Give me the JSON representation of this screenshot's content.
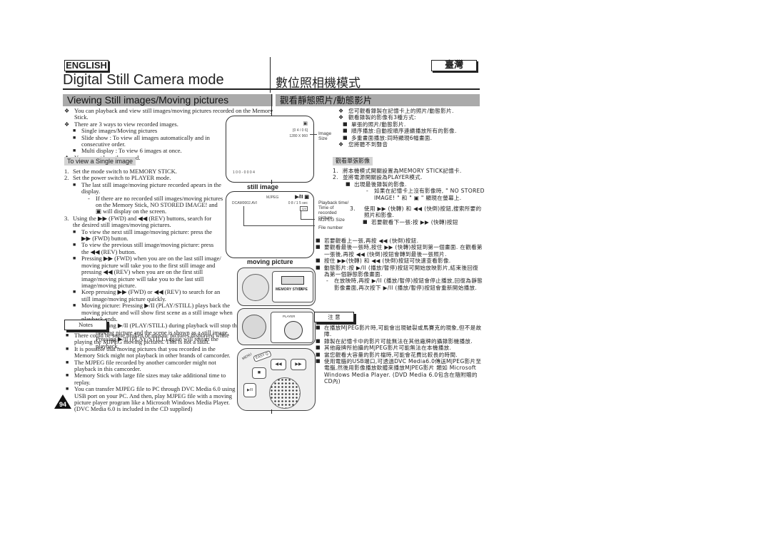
{
  "header": {
    "lang_en": "ENGLISH",
    "lang_zh": "臺灣",
    "title_en": "Digital Still Camera mode",
    "title_zh": "數位照相機模式",
    "section_en": "Viewing Still images/Moving pictures",
    "section_zh": "觀看靜態照片/動態影片"
  },
  "intro_en": [
    {
      "bullet": "diamond",
      "text": "You can playback and view still images/moving pictures recorded on the Memory Stick."
    },
    {
      "bullet": "diamond",
      "text": "There are 3 ways to view recorded images."
    },
    {
      "bullet": "square",
      "text": "Single images/Moving pictures"
    },
    {
      "bullet": "square",
      "text": "Slide show : To view all images automatically and in consecutive order."
    },
    {
      "bullet": "square",
      "text": "Multi display : To view 6 images at once."
    },
    {
      "bullet": "diamond",
      "text": "You cannot hear the sound."
    }
  ],
  "subsection_en": "To view a Single image",
  "steps_en": {
    "s1": "Set the mode switch to MEMORY STICK.",
    "s2": "Set the power switch to PLAYER mode.",
    "s2a": "The last still image/moving picture recorded apears in the display.",
    "s2b": "If there are no recorded still images/moving pictures on the Memory Stick, NO STORED IMAGE! and ▣ will display on the screen.",
    "s3": "Using the ▶▶ (FWD) and ◀◀ (REV) buttons, search for the desired still images/moving pictures.",
    "s3a": "To view the next still image/moving picture: press the ▶▶ (FWD) button.",
    "s3b": "To view the previous still image/moving picture: press the ◀◀ (REV) button.",
    "s3c": "Pressing ▶▶ (FWD) when you are on the last still image/ moving picture will take you to the first still image and pressing ◀◀ (REV) when you are on the first still image/moving picture will take you to the last still image/moving picture.",
    "s3d": "Keep pressing ▶▶ (FWD) or ◀◀ (REV) to search for an still image/moving picture quickly.",
    "s3e": "Moving picture: Pressing ▶/II (PLAY/STILL) plays back the moving picture and will show first scene as a still image when playback ends.",
    "s3f": "Pressing ▶/II (PLAY/STILL) during playback will stop the moving picture and the scene is shown as a still image. Pressing ▶/II (PLAY/STILL) again will restart the playback.",
    "n1": "1.",
    "n2": "2.",
    "n3": "3."
  },
  "notes_en": {
    "title": "Notes",
    "items": [
      "There could be some broken or mosaic pictures displayed while playing the MJPEG moving pictures. This is not a fault.",
      "It is possible that moving pictures that you recorded in the Memory Stick might not playback in other brands of camcorder.",
      "The MJPEG file recorded by another camcorder might not playback in this camcorder.",
      "Memory Stick with large file sizes may take additional time to replay.",
      "You can transfer MJPEG file to PC through DVC Media 6.0 using USB port on your PC. And then, play MJPEG file with a moving picture player program like a Microsoft Windows Media Player. (DVC Media 6.0 is included in the CD supplied)"
    ]
  },
  "page_number": "94",
  "figure": {
    "screen1": {
      "icon": "▣",
      "counter": "[0 4 / 0 6]",
      "size": "1280 X 960",
      "folder": "1 0 0 - 0 0 0 4"
    },
    "label_image_size": "Image Size",
    "caption_still": "still image",
    "screen2": {
      "format": "MJPEG",
      "play_icon": "▶/II ▣",
      "filename": "DCAM0002.AVI",
      "time": "0 8 / 1 5 sec",
      "size_icon": "320"
    },
    "label_playback": "Playback time/ Time of recorded picture",
    "label_mjpeg_size": "MJPEG Size",
    "label_file_number": "File number",
    "caption_moving": "moving picture",
    "switch_memory": "MEMORY STICK",
    "switch_tape": "TAPE",
    "dial_label": "PLAYER",
    "btn_rev": "◀◀",
    "btn_fwd": "▶▶",
    "btn_stop": "■",
    "btn_play": "▶/II",
    "btn_easy": "EASY Q",
    "btn_menu": "MENU"
  },
  "intro_zh": [
    {
      "bullet": "diamond",
      "text": "您可觀看錄製在記憶卡上的照片/動態影片."
    },
    {
      "bullet": "diamond",
      "text": "觀看錄製的影像有3種方式:"
    },
    {
      "bullet": "square",
      "text": "單張的照片/動態影片."
    },
    {
      "bullet": "square",
      "text": "順序播放:自動按順序連續播放所有的影像."
    },
    {
      "bullet": "square",
      "text": "多重畫面播放:同時顯現6幅畫面."
    },
    {
      "bullet": "diamond",
      "text": "您將聽不到聲音"
    }
  ],
  "subsection_zh": "觀看單張影像",
  "steps_zh": {
    "s1": "將本機模式開關設置為MEMORY STICK記憶卡.",
    "s2": "並將電源開關設為PLAYER模式.",
    "s2a": "出現最後錄製的影像.",
    "s2b": "如果在記憶卡上沒有影像時, \" NO STORED IMAGE! \" 和 \" ▣ \" 顯現在螢幕上.",
    "s3": "使用 ▶▶ (快轉) 和 ◀◀ (快倒)按鈕,搜索所要的照片和影像.",
    "s3a": "若要觀看下一張:按 ▶▶ (快轉)按鈕",
    "s3b": "若要觀看上一張,再按 ◀◀ (快倒)按鈕.",
    "s3c": "要觀看最後一張時,按住 ▶▶ (快轉)按鈕到第一個畫面. 在觀看第一張後,再按 ◀◀ (快倒)按鈕會轉到最後一張照片.",
    "s3d": "按住 ▶▶(快轉) 和 ◀◀ (快倒)按鈕可快速查看影像.",
    "s3e": "動態影片:按 ▶/II (播放/暫停)按鈕可開始放映影片,結束後回復為第一個靜態影像畫面.",
    "s3f": "在放映時,再按 ▶/II (播放/暫停)按鈕會停止播放,回復為靜態影像畫面,再次按下 ▶/II (播放/暫停)按鈕會重新開始播放.",
    "n1": "1.",
    "n2": "2.",
    "n3": "3."
  },
  "notes_zh": {
    "title": "注 意",
    "items": [
      "在播放MJPEG影片時,可能會出現破裂或馬賽克的現象,但不是故障.",
      "錄製在記憶卡中的影片可能無法在其他廠牌的攝錄影機播放.",
      "其他廠牌所拍攝的MJPEG影片可能無法在本機播放.",
      "當您觀看大容量的影片檔時,可能會花費比較長的時間.",
      "使用電腦的USB端口,可透過DVC Media6.0傳送MJPEG影片至電腦,然後用影像播放軟體來播放MJPEG影片 類如 Microsoft Windows Media Player. (DVD Media 6.0包含在隨附贈的CD內)"
    ]
  },
  "colors": {
    "section_bar": "#aaaaaa",
    "subsection_bar": "#d4d4d4",
    "text": "#222222"
  }
}
